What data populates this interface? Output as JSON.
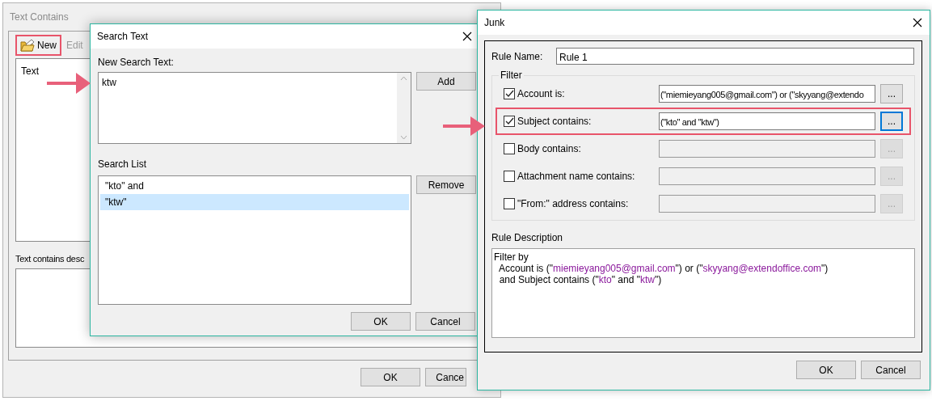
{
  "text_contains_window": {
    "title": "Text Contains",
    "toolbar": [
      {
        "label": "New",
        "kind": "new",
        "disabled": false,
        "highlighted": true
      },
      {
        "label": "Edit",
        "kind": "edit",
        "disabled": true,
        "highlighted": false
      }
    ],
    "list_items": [
      "Text"
    ],
    "description_label": "Text contains desc",
    "buttons": [
      "OK",
      "Cance"
    ]
  },
  "search_text_dialog": {
    "title": "Search Text",
    "new_search_label": "New Search Text:",
    "new_search_value": "ktw",
    "add_button": "Add",
    "search_list_label": "Search List",
    "search_list": [
      {
        "text": "\"kto\" and",
        "selected": false
      },
      {
        "text": "\"ktw\"",
        "selected": true
      }
    ],
    "remove_button": "Remove",
    "buttons": [
      "OK",
      "Cancel"
    ]
  },
  "junk_dialog": {
    "title": "Junk",
    "rule_name_label": "Rule Name:",
    "rule_name": "Rule 1",
    "filter_label": "Filter",
    "filters": [
      {
        "label": "Account is:",
        "checked": true,
        "value": "(\"miemieyang005@gmail.com\") or (\"skyyang@extendo",
        "button": "...",
        "disabled": false,
        "focused": false,
        "highlighted": false
      },
      {
        "label": "Subject contains:",
        "checked": true,
        "value": "(\"kto\" and \"ktw\")",
        "button": "...",
        "disabled": false,
        "focused": true,
        "highlighted": true
      },
      {
        "label": "Body contains:",
        "checked": false,
        "button": "...",
        "disabled": true,
        "focused": false,
        "highlighted": false
      },
      {
        "label": "Attachment name contains:",
        "checked": false,
        "button": "...",
        "disabled": true,
        "focused": false,
        "highlighted": false
      },
      {
        "label": "\"From:\" address contains:",
        "checked": false,
        "button": "...",
        "disabled": true,
        "focused": false,
        "highlighted": false
      }
    ],
    "description_label": "Rule Description",
    "description_lines": [
      [
        {
          "text": "Filter by",
          "kind": "plain"
        }
      ],
      [
        {
          "text": "  Account is (\"",
          "kind": "plain"
        },
        {
          "text": "miemieyang005@gmail.com",
          "kind": "value"
        },
        {
          "text": "\") or (\"",
          "kind": "plain"
        },
        {
          "text": "skyyang@extendoffice.com",
          "kind": "value"
        },
        {
          "text": "\")",
          "kind": "plain"
        }
      ],
      [
        {
          "text": "  and Subject contains (\"",
          "kind": "plain"
        },
        {
          "text": "kto",
          "kind": "value"
        },
        {
          "text": "\" and \"",
          "kind": "plain"
        },
        {
          "text": "ktw",
          "kind": "value"
        },
        {
          "text": "\")",
          "kind": "plain"
        }
      ]
    ],
    "buttons": [
      "OK",
      "Cancel"
    ]
  }
}
